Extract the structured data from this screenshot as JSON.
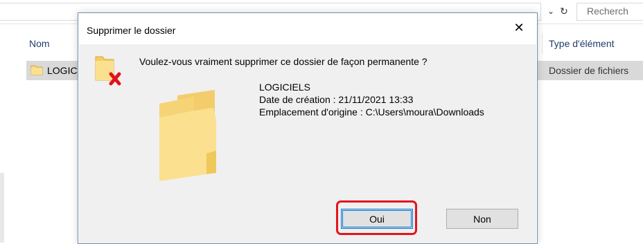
{
  "explorer": {
    "search_placeholder": "Recherch",
    "chevron_glyph": "⌄",
    "refresh_glyph": "↻",
    "column_name": "Nom",
    "column_type": "Type d'élément",
    "row": {
      "name": "LOGIC",
      "type": "Dossier de fichiers"
    }
  },
  "dialog": {
    "title": "Supprimer le dossier",
    "close_glyph": "✕",
    "question": "Voulez-vous vraiment supprimer ce dossier de façon permanente ?",
    "folder_name": "LOGICIELS",
    "created": "Date de création : 21/11/2021 13:33",
    "location": "Emplacement d'origine : C:\\Users\\moura\\Downloads",
    "yes_label": "Oui",
    "no_label": "Non"
  },
  "colors": {
    "highlight": "#e5131d",
    "focus": "#0078d7",
    "folder": "#f8d775",
    "delete_x": "#e0121b"
  }
}
